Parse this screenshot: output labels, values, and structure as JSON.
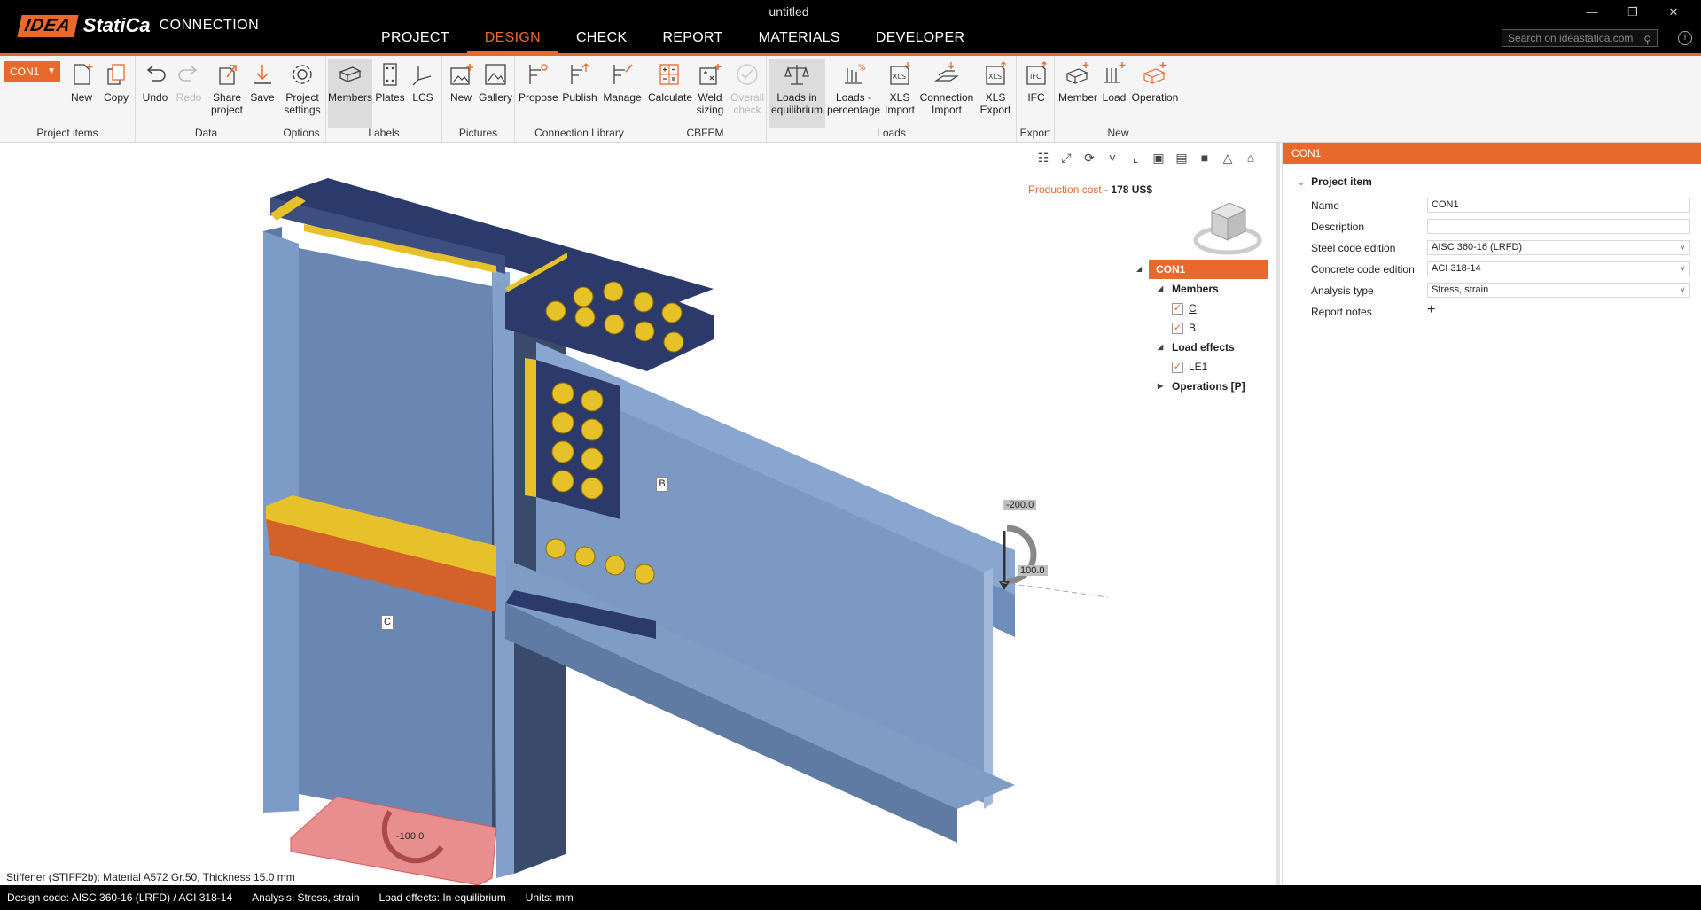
{
  "app": {
    "window_title": "untitled",
    "brand_idea": "IDEA",
    "brand_statica": "StatiCa",
    "brand_product": "CONNECTION",
    "search_placeholder": "Search on ideastatica.com"
  },
  "main_tabs": [
    {
      "label": "PROJECT",
      "active": false
    },
    {
      "label": "DESIGN",
      "active": true
    },
    {
      "label": "CHECK",
      "active": false
    },
    {
      "label": "REPORT",
      "active": false
    },
    {
      "label": "MATERIALS",
      "active": false
    },
    {
      "label": "DEVELOPER",
      "active": false
    }
  ],
  "ribbon": {
    "connection_selector": "CON1",
    "groups": {
      "project_items": "Project items",
      "data": "Data",
      "options": "Options",
      "labels": "Labels",
      "pictures": "Pictures",
      "connection_library": "Connection Library",
      "cbfem": "CBFEM",
      "loads": "Loads",
      "export": "Export",
      "new": "New"
    },
    "buttons": {
      "new": "New",
      "copy": "Copy",
      "undo": "Undo",
      "redo": "Redo",
      "share_project": "Share project",
      "save": "Save",
      "project_settings": "Project settings",
      "members": "Members",
      "plates": "Plates",
      "lcs": "LCS",
      "pic_new": "New",
      "gallery": "Gallery",
      "propose": "Propose",
      "publish": "Publish",
      "manage": "Manage",
      "calculate": "Calculate",
      "weld_sizing": "Weld sizing",
      "overall_check": "Overall check",
      "loads_in_equilibrium": "Loads in equilibrium",
      "loads_percentage": "Loads - percentage",
      "xls_import": "XLS Import",
      "connection_import": "Connection Import",
      "xls_export": "XLS Export",
      "ifc": "IFC",
      "member": "Member",
      "load": "Load",
      "operation": "Operation"
    }
  },
  "viewport": {
    "production_cost_label": "Production cost",
    "production_cost_value": "178 US$",
    "labels": {
      "beam": "B",
      "column": "C"
    },
    "load_values": {
      "moment": "-200.0",
      "shear": "100.0",
      "axial": "-100.0"
    },
    "selection_status": "Stiffener (STIFF2b): Material A572 Gr.50, Thickness  15.0 mm"
  },
  "tree": {
    "root": "CON1",
    "members_label": "Members",
    "members": [
      {
        "name": "C",
        "checked": true
      },
      {
        "name": "B",
        "checked": true
      }
    ],
    "load_effects_label": "Load effects",
    "load_effects": [
      {
        "name": "LE1",
        "checked": true
      }
    ],
    "operations_label": "Operations [P]"
  },
  "properties": {
    "header": "CON1",
    "section": "Project item",
    "rows": [
      {
        "label": "Name",
        "value": "CON1",
        "dropdown": false
      },
      {
        "label": "Description",
        "value": "",
        "dropdown": false
      },
      {
        "label": "Steel code edition",
        "value": "AISC 360-16 (LRFD)",
        "dropdown": true
      },
      {
        "label": "Concrete code edition",
        "value": "ACI 318-14",
        "dropdown": true
      },
      {
        "label": "Analysis type",
        "value": "Stress, strain",
        "dropdown": true
      },
      {
        "label": "Report notes",
        "value": "+",
        "dropdown": false
      }
    ]
  },
  "statusbar": {
    "design_code": "Design code: AISC 360-16 (LRFD) / ACI 318-14",
    "analysis": "Analysis: Stress, strain",
    "load_effects": "Load effects: In equilibrium",
    "units": "Units: mm"
  },
  "colors": {
    "accent": "#e9692c",
    "steel": "#7e9cc4",
    "steel_dark": "#2b3a6b",
    "bolt": "#e6c12a"
  }
}
